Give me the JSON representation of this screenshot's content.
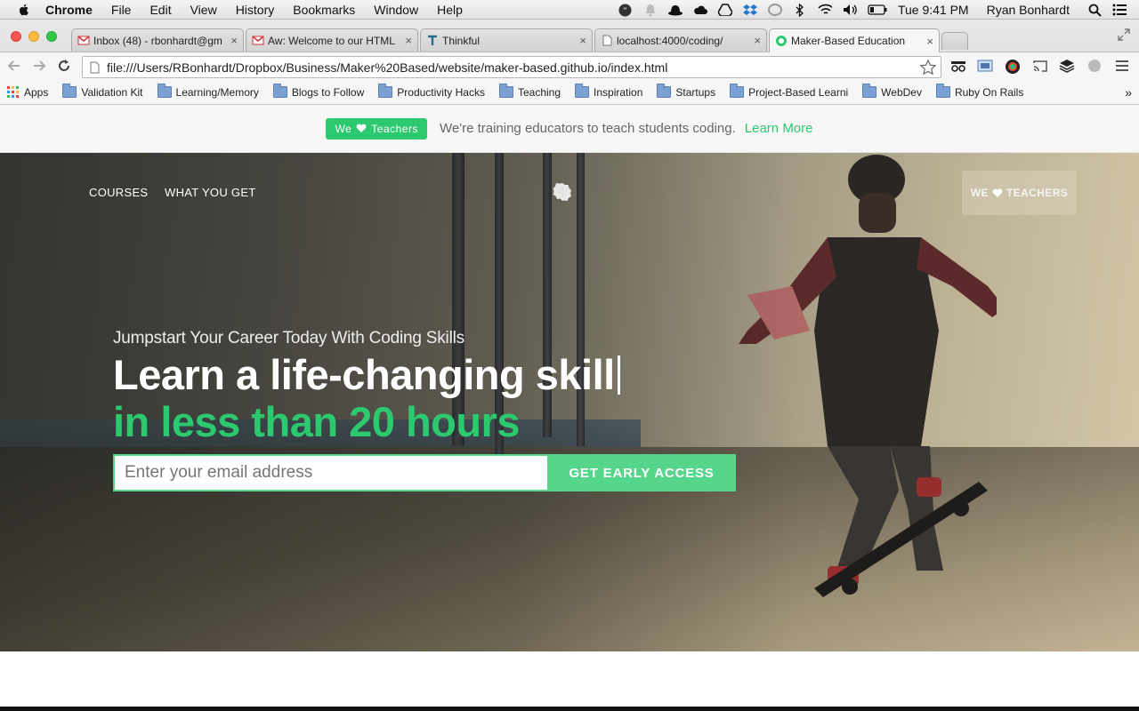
{
  "menubar": {
    "app": "Chrome",
    "items": [
      "File",
      "Edit",
      "View",
      "History",
      "Bookmarks",
      "Window",
      "Help"
    ],
    "clock": "Tue 9:41 PM",
    "user": "Ryan Bonhardt"
  },
  "tabs": [
    {
      "title": "Inbox (48) - rbonhardt@gm",
      "icon": "gmail-icon"
    },
    {
      "title": "Aw: Welcome to our HTML",
      "icon": "gmail-icon"
    },
    {
      "title": "Thinkful",
      "icon": "thinkful-icon"
    },
    {
      "title": "localhost:4000/coding/",
      "icon": "page-icon"
    },
    {
      "title": "Maker-Based Education",
      "icon": "maker-icon"
    }
  ],
  "url": "file:///Users/RBonhardt/Dropbox/Business/Maker%20Based/website/maker-based.github.io/index.html",
  "bookmarks": {
    "apps_label": "Apps",
    "items": [
      "Validation Kit",
      "Learning/Memory",
      "Blogs to Follow",
      "Productivity Hacks",
      "Teaching",
      "Inspiration",
      "Startups",
      "Project-Based Learni",
      "WebDev",
      "Ruby On Rails"
    ],
    "overflow": "»"
  },
  "announce": {
    "badge_prefix": "We",
    "badge_suffix": "Teachers",
    "text": "We're training educators to teach students coding.",
    "link": "Learn More"
  },
  "hero": {
    "nav": [
      "COURSES",
      "WHAT YOU GET"
    ],
    "teach_button_prefix": "WE",
    "teach_button_suffix": "TEACHERS",
    "subhead": "Jumpstart Your Career Today With Coding Skills",
    "headline1": "Learn a life-changing skill",
    "headline2": "in less than 20 hours",
    "email_placeholder": "Enter your email address",
    "cta": "GET EARLY ACCESS"
  },
  "colors": {
    "accent": "#2dc96f",
    "cta": "#56d68b"
  }
}
